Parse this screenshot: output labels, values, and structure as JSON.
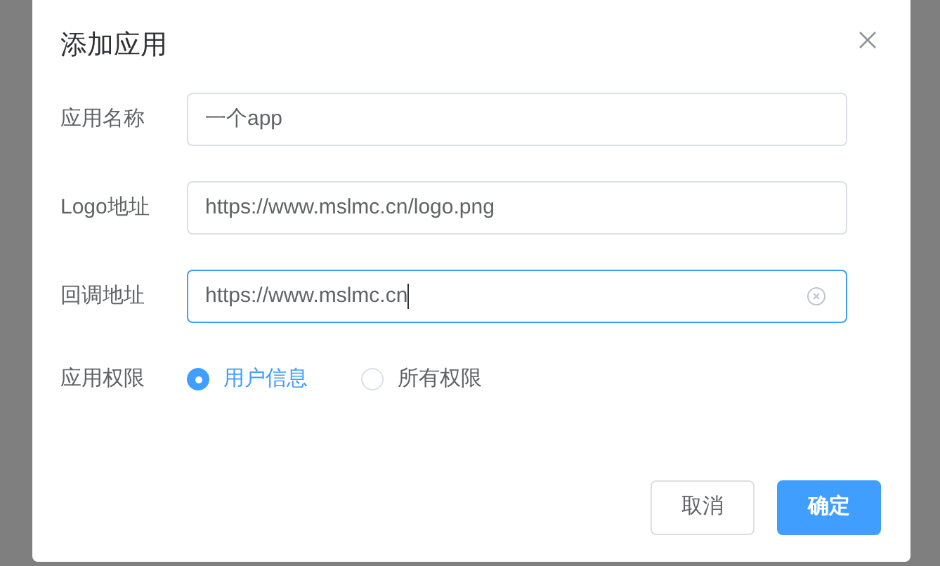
{
  "dialog": {
    "title": "添加应用"
  },
  "fields": [
    {
      "label": "应用名称",
      "value": "一个app",
      "focused": false
    },
    {
      "label": "Logo地址",
      "value": "https://www.mslmc.cn/logo.png",
      "focused": false
    },
    {
      "label": "回调地址",
      "value": "https://www.mslmc.cn",
      "focused": true
    }
  ],
  "permission": {
    "label": "应用权限",
    "options": [
      {
        "label": "用户信息",
        "selected": true
      },
      {
        "label": "所有权限",
        "selected": false
      }
    ]
  },
  "buttons": [
    {
      "label": "取消",
      "kind": "default"
    },
    {
      "label": "确定",
      "kind": "primary"
    }
  ]
}
